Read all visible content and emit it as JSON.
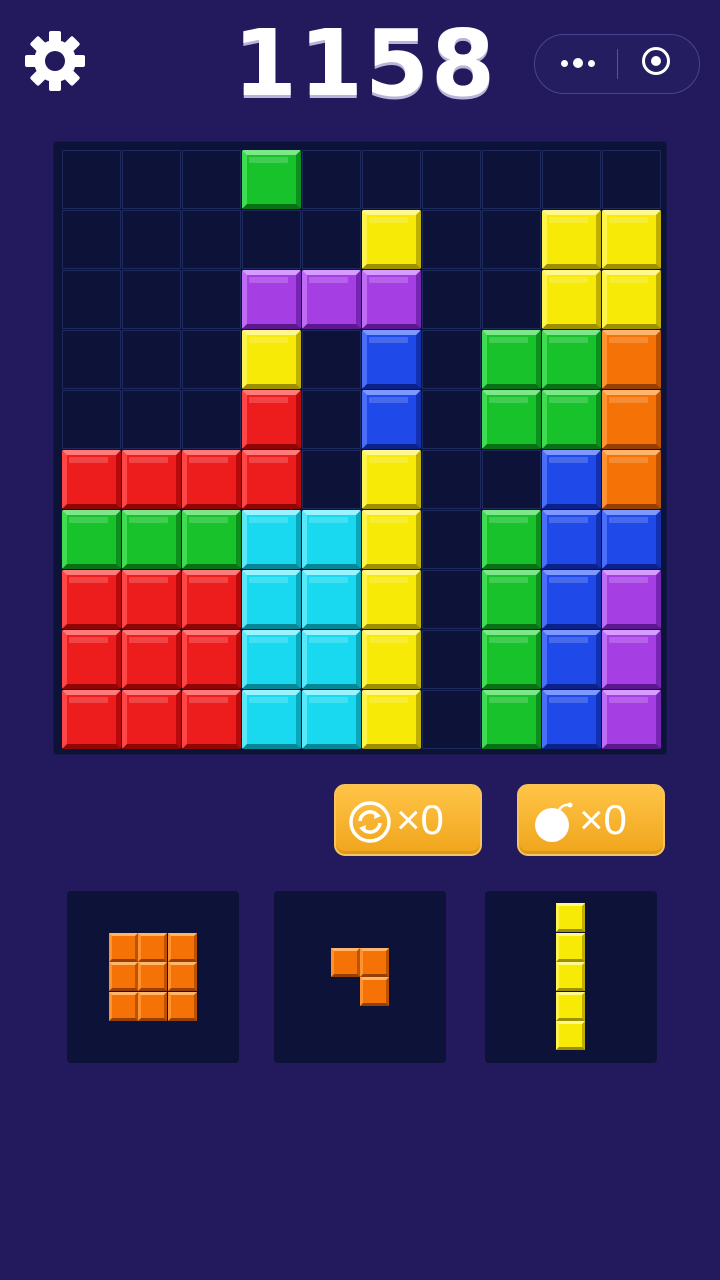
{
  "header": {
    "score": "1158"
  },
  "icons": {
    "settings": "gear-icon",
    "more": "more-dots-icon",
    "close": "target-close-icon"
  },
  "palette": {
    "red": {
      "face": "#ee1d1d",
      "top": "#ff7a7a",
      "left": "#ff4646",
      "right": "#b80a0a",
      "bottom": "#8f0606"
    },
    "green": {
      "face": "#17c22b",
      "top": "#7de88a",
      "left": "#3fdc52",
      "right": "#0c8f1d",
      "bottom": "#0a7016"
    },
    "yellow": {
      "face": "#f7ea06",
      "top": "#fff88f",
      "left": "#fff44a",
      "right": "#bfb000",
      "bottom": "#9c8f00"
    },
    "purple": {
      "face": "#a53fe4",
      "top": "#d69cff",
      "left": "#bf6cf5",
      "right": "#7624b2",
      "bottom": "#5c188f"
    },
    "blue": {
      "face": "#1f49e8",
      "top": "#7d98ff",
      "left": "#4a6dfa",
      "right": "#1230b0",
      "bottom": "#0c2189"
    },
    "cyan": {
      "face": "#18d9ef",
      "top": "#9af4ff",
      "left": "#5ae8f8",
      "right": "#0aa7bb",
      "bottom": "#078796"
    },
    "orange": {
      "face": "#f47206",
      "top": "#ffb66c",
      "left": "#ff9230",
      "right": "#bd5203",
      "bottom": "#963f02"
    }
  },
  "board": {
    "size": 10,
    "cells": [
      [
        "",
        "",
        "",
        "green",
        "",
        "",
        "",
        "",
        "",
        ""
      ],
      [
        "",
        "",
        "",
        "",
        "",
        "yellow",
        "",
        "",
        "yellow",
        "yellow"
      ],
      [
        "",
        "",
        "",
        "purple",
        "purple",
        "purple",
        "",
        "",
        "yellow",
        "yellow"
      ],
      [
        "",
        "",
        "",
        "yellow",
        "",
        "blue",
        "",
        "green",
        "green",
        "orange"
      ],
      [
        "",
        "",
        "",
        "red",
        "",
        "blue",
        "",
        "green",
        "green",
        "orange"
      ],
      [
        "red",
        "red",
        "red",
        "red",
        "",
        "yellow",
        "",
        "",
        "blue",
        "orange"
      ],
      [
        "green",
        "green",
        "green",
        "cyan",
        "cyan",
        "yellow",
        "",
        "green",
        "blue",
        "blue"
      ],
      [
        "red",
        "red",
        "red",
        "cyan",
        "cyan",
        "yellow",
        "",
        "green",
        "blue",
        "purple"
      ],
      [
        "red",
        "red",
        "red",
        "cyan",
        "cyan",
        "yellow",
        "",
        "green",
        "blue",
        "purple"
      ],
      [
        "red",
        "red",
        "red",
        "cyan",
        "cyan",
        "yellow",
        "",
        "green",
        "blue",
        "purple"
      ]
    ]
  },
  "powerups": [
    {
      "id": "refresh",
      "icon": "refresh-icon",
      "count": "×0"
    },
    {
      "id": "bomb",
      "icon": "bomb-icon",
      "count": "×0"
    }
  ],
  "pieces": [
    {
      "id": "piece-1",
      "color": "orange",
      "cells": [
        [
          1,
          1,
          1
        ],
        [
          1,
          1,
          1
        ],
        [
          1,
          1,
          1
        ]
      ]
    },
    {
      "id": "piece-2",
      "color": "orange",
      "cells": [
        [
          1,
          1
        ],
        [
          0,
          1
        ]
      ]
    },
    {
      "id": "piece-3",
      "color": "yellow",
      "cells": [
        [
          1
        ],
        [
          1
        ],
        [
          1
        ],
        [
          1
        ],
        [
          1
        ]
      ]
    }
  ]
}
